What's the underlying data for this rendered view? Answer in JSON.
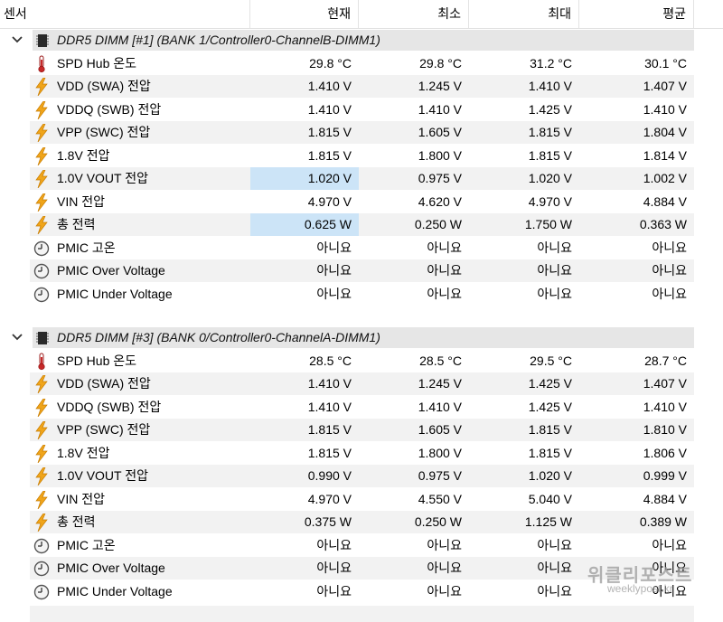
{
  "columns": {
    "sensor": "센서",
    "current": "현재",
    "min": "최소",
    "max": "최대",
    "avg": "평균"
  },
  "groups": [
    {
      "title": "DDR5 DIMM [#1] (BANK 1/Controller0-ChannelB-DIMM1)",
      "rows": [
        {
          "icon": "thermometer-icon",
          "name": "SPD Hub 온도",
          "cur": "29.8 °C",
          "min": "29.8 °C",
          "max": "31.2 °C",
          "avg": "30.1 °C"
        },
        {
          "icon": "voltage-bolt-icon",
          "name": "VDD (SWA) 전압",
          "cur": "1.410 V",
          "min": "1.245 V",
          "max": "1.410 V",
          "avg": "1.407 V"
        },
        {
          "icon": "voltage-bolt-icon",
          "name": "VDDQ (SWB) 전압",
          "cur": "1.410 V",
          "min": "1.410 V",
          "max": "1.425 V",
          "avg": "1.410 V"
        },
        {
          "icon": "voltage-bolt-icon",
          "name": "VPP (SWC) 전압",
          "cur": "1.815 V",
          "min": "1.605 V",
          "max": "1.815 V",
          "avg": "1.804 V"
        },
        {
          "icon": "voltage-bolt-icon",
          "name": "1.8V 전압",
          "cur": "1.815 V",
          "min": "1.800 V",
          "max": "1.815 V",
          "avg": "1.814 V"
        },
        {
          "icon": "voltage-bolt-icon",
          "name": "1.0V VOUT 전압",
          "cur": "1.020 V",
          "min": "0.975 V",
          "max": "1.020 V",
          "avg": "1.002 V",
          "sel": true
        },
        {
          "icon": "voltage-bolt-icon",
          "name": "VIN 전압",
          "cur": "4.970 V",
          "min": "4.620 V",
          "max": "4.970 V",
          "avg": "4.884 V"
        },
        {
          "icon": "power-bolt-icon",
          "name": "총 전력",
          "cur": "0.625 W",
          "min": "0.250 W",
          "max": "1.750 W",
          "avg": "0.363 W",
          "sel": true
        },
        {
          "icon": "clock-gauge-icon",
          "name": "PMIC 고온",
          "cur": "아니요",
          "min": "아니요",
          "max": "아니요",
          "avg": "아니요"
        },
        {
          "icon": "clock-gauge-icon",
          "name": "PMIC Over Voltage",
          "cur": "아니요",
          "min": "아니요",
          "max": "아니요",
          "avg": "아니요"
        },
        {
          "icon": "clock-gauge-icon",
          "name": "PMIC Under Voltage",
          "cur": "아니요",
          "min": "아니요",
          "max": "아니요",
          "avg": "아니요"
        }
      ]
    },
    {
      "title": "DDR5 DIMM [#3] (BANK 0/Controller0-ChannelA-DIMM1)",
      "rows": [
        {
          "icon": "thermometer-icon",
          "name": "SPD Hub 온도",
          "cur": "28.5 °C",
          "min": "28.5 °C",
          "max": "29.5 °C",
          "avg": "28.7 °C"
        },
        {
          "icon": "voltage-bolt-icon",
          "name": "VDD (SWA) 전압",
          "cur": "1.410 V",
          "min": "1.245 V",
          "max": "1.425 V",
          "avg": "1.407 V"
        },
        {
          "icon": "voltage-bolt-icon",
          "name": "VDDQ (SWB) 전압",
          "cur": "1.410 V",
          "min": "1.410 V",
          "max": "1.425 V",
          "avg": "1.410 V"
        },
        {
          "icon": "voltage-bolt-icon",
          "name": "VPP (SWC) 전압",
          "cur": "1.815 V",
          "min": "1.605 V",
          "max": "1.815 V",
          "avg": "1.810 V"
        },
        {
          "icon": "voltage-bolt-icon",
          "name": "1.8V 전압",
          "cur": "1.815 V",
          "min": "1.800 V",
          "max": "1.815 V",
          "avg": "1.806 V"
        },
        {
          "icon": "voltage-bolt-icon",
          "name": "1.0V VOUT 전압",
          "cur": "0.990 V",
          "min": "0.975 V",
          "max": "1.020 V",
          "avg": "0.999 V"
        },
        {
          "icon": "voltage-bolt-icon",
          "name": "VIN 전압",
          "cur": "4.970 V",
          "min": "4.550 V",
          "max": "5.040 V",
          "avg": "4.884 V"
        },
        {
          "icon": "power-bolt-icon",
          "name": "총 전력",
          "cur": "0.375 W",
          "min": "0.250 W",
          "max": "1.125 W",
          "avg": "0.389 W"
        },
        {
          "icon": "clock-gauge-icon",
          "name": "PMIC 고온",
          "cur": "아니요",
          "min": "아니요",
          "max": "아니요",
          "avg": "아니요"
        },
        {
          "icon": "clock-gauge-icon",
          "name": "PMIC Over Voltage",
          "cur": "아니요",
          "min": "아니요",
          "max": "아니요",
          "avg": "아니요"
        },
        {
          "icon": "clock-gauge-icon",
          "name": "PMIC Under Voltage",
          "cur": "아니요",
          "min": "아니요",
          "max": "아니요",
          "avg": "아니요"
        }
      ]
    }
  ],
  "watermark": {
    "logo": "위클리포스트",
    "url": "weeklypost.kr"
  },
  "colors": {
    "selection": "#cce4f7",
    "group_header": "#e6e6e6",
    "row_alt": "#f2f2f2",
    "bolt": "#f0a51a",
    "thermo": "#c62828"
  }
}
